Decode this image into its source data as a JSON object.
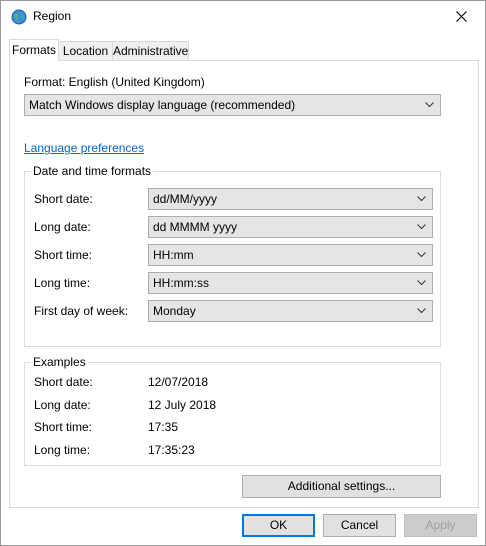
{
  "window": {
    "title": "Region",
    "title_icon": "globe-icon",
    "close_icon": "close-icon"
  },
  "tabs": [
    {
      "label": "Formats",
      "active": true
    },
    {
      "label": "Location",
      "active": false
    },
    {
      "label": "Administrative",
      "active": false
    }
  ],
  "formats": {
    "format_label": "Format: English (United Kingdom)",
    "format_value": "Match Windows display language (recommended)",
    "language_link": "Language preferences",
    "datetime_group": {
      "title": "Date and time formats",
      "rows": [
        {
          "label": "Short date:",
          "value": "dd/MM/yyyy"
        },
        {
          "label": "Long date:",
          "value": "dd MMMM yyyy"
        },
        {
          "label": "Short time:",
          "value": "HH:mm"
        },
        {
          "label": "Long time:",
          "value": "HH:mm:ss"
        },
        {
          "label": "First day of week:",
          "value": "Monday"
        }
      ]
    },
    "examples_group": {
      "title": "Examples",
      "rows": [
        {
          "label": "Short date:",
          "value": "12/07/2018"
        },
        {
          "label": "Long date:",
          "value": "12 July 2018"
        },
        {
          "label": "Short time:",
          "value": "17:35"
        },
        {
          "label": "Long time:",
          "value": "17:35:23"
        }
      ]
    },
    "additional_settings": "Additional settings..."
  },
  "footer": {
    "ok": "OK",
    "cancel": "Cancel",
    "apply": "Apply"
  },
  "colors": {
    "link": "#0066cc",
    "accent": "#0078d7",
    "combo_bg": "#e5e5e5"
  }
}
